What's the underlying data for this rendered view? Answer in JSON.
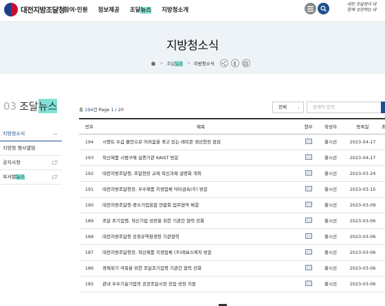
{
  "header": {
    "logo_text": "대전지방조달청",
    "gnb": [
      {
        "label": "참여·민원"
      },
      {
        "label": "정보제공"
      },
      {
        "label_pre": "조달",
        "label_hl": "뉴스"
      },
      {
        "label": "지방청소개"
      }
    ],
    "slogan_line1": "대한 조달청이 대",
    "slogan_line2": "함께 성장하는 대"
  },
  "visual": {
    "title": "지방청소식",
    "breadcrumb": {
      "item1_pre": "조달",
      "item1_hl": "뉴스",
      "item2": "지방청소식"
    }
  },
  "lnb": {
    "num": "03",
    "title_pre": "조달",
    "title_hl": "뉴스",
    "items": [
      {
        "label": "지방청소식",
        "mark": "−"
      },
      {
        "label": "지방청 행사앨범"
      },
      {
        "label": "공지사항"
      },
      {
        "label_pre": "부서별",
        "label_hl": "뉴스"
      }
    ]
  },
  "board": {
    "total_label": "총 ",
    "total": "194",
    "total_suffix": "건 Page ",
    "page": "1",
    "pages": " / 20",
    "select_value": "전체",
    "search_placeholder": "검색어 입력",
    "columns": {
      "no": "번호",
      "title": "제목",
      "file": "첨부",
      "author": "작성자",
      "date": "등록일",
      "views": "조"
    },
    "rows": [
      {
        "no": "194",
        "title": "시멘트 수급 불안으로 어려움을 겪고 있는 레미콘 생산현장 점검",
        "author": "황시선",
        "date": "2023-04-17"
      },
      {
        "no": "193",
        "title": "혁신제품 시범구매 실증기관 KAIST 방문",
        "author": "황시선",
        "date": "2023-04-17"
      },
      {
        "no": "192",
        "title": "대전지방조달청, 조달현장 규제 혁신과제 설명회 개최",
        "author": "황시선",
        "date": "2023-03-24"
      },
      {
        "no": "191",
        "title": "대전지방조달청장, 우수제품 지정업체 닥터금속(주) 방문",
        "author": "황시선",
        "date": "2023-03-15"
      },
      {
        "no": "190",
        "title": "대전지방조달청-중소기업융합 연합회 업무협약 체결",
        "author": "황시선",
        "date": "2023-03-09"
      },
      {
        "no": "189",
        "title": "조달 조기집행, 혁신기업 성장을 위한 기관간 협력 강화",
        "author": "황시선",
        "date": "2023-03-06"
      },
      {
        "no": "188",
        "title": "대전지방조달청 공정유역환경청 기관협력",
        "author": "황시선",
        "date": "2023-03-06"
      },
      {
        "no": "187",
        "title": "대전지방조달청장, 혁신제품 지정업체 (주)레보스케치 방문",
        "author": "황시선",
        "date": "2023-03-06"
      },
      {
        "no": "186",
        "title": "경제위기 극복을 위한 조달조기집행 기관간 협력 강화",
        "author": "황시선",
        "date": "2023-03-06"
      },
      {
        "no": "185",
        "title": "관내 우수기술기업의 공공조달시장 진입·성장 지원",
        "author": "황시선",
        "date": "2023-03-06"
      }
    ]
  },
  "colors": {
    "accent": "#1f4f8f",
    "highlight": "#7fe0d3",
    "visual_bg": "#eef3f8"
  }
}
